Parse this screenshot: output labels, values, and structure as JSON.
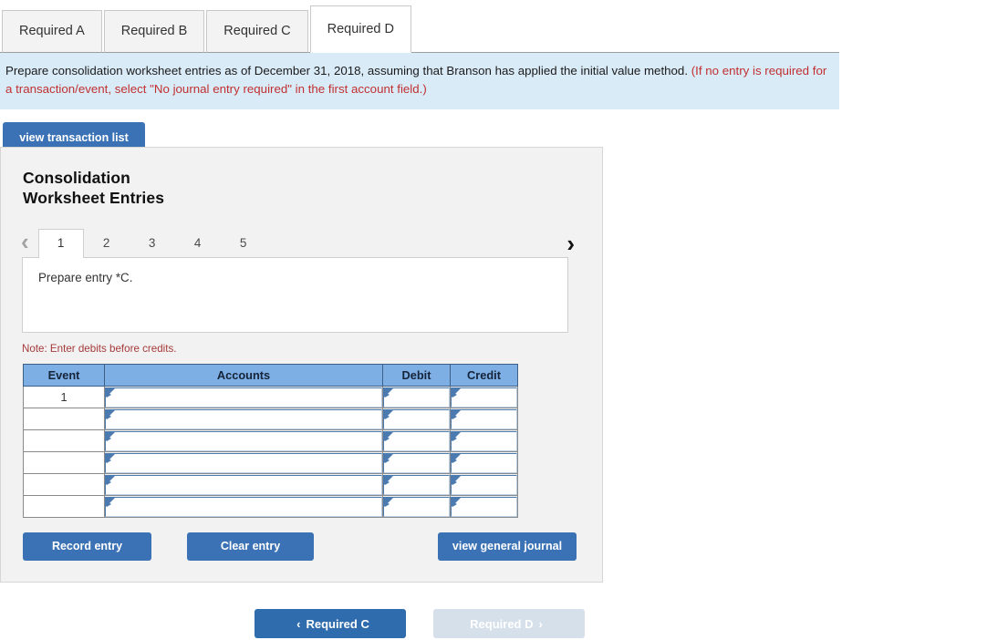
{
  "tabs": [
    {
      "label": "Required A",
      "active": false
    },
    {
      "label": "Required B",
      "active": false
    },
    {
      "label": "Required C",
      "active": false
    },
    {
      "label": "Required D",
      "active": true
    }
  ],
  "banner": {
    "main": "Prepare consolidation worksheet entries as of December 31, 2018, assuming that Branson has applied the initial value method.",
    "hint": "(If no entry is required for a transaction/event, select \"No journal entry required\" in the first account field.)"
  },
  "toolbar": {
    "view_transaction_list": "view transaction list"
  },
  "panel": {
    "title_line1": "Consolidation",
    "title_line2": "Worksheet Entries",
    "pager": {
      "prev_icon": "‹",
      "next_icon": "›",
      "pages": [
        "1",
        "2",
        "3",
        "4",
        "5"
      ],
      "active_page": "1"
    },
    "entry_description": "Prepare entry *C.",
    "note": "Note: Enter debits before credits.",
    "table": {
      "headers": [
        "Event",
        "Accounts",
        "Debit",
        "Credit"
      ],
      "rows": [
        {
          "event": "1",
          "accounts": "",
          "debit": "",
          "credit": ""
        },
        {
          "event": "",
          "accounts": "",
          "debit": "",
          "credit": ""
        },
        {
          "event": "",
          "accounts": "",
          "debit": "",
          "credit": ""
        },
        {
          "event": "",
          "accounts": "",
          "debit": "",
          "credit": ""
        },
        {
          "event": "",
          "accounts": "",
          "debit": "",
          "credit": ""
        },
        {
          "event": "",
          "accounts": "",
          "debit": "",
          "credit": ""
        }
      ]
    },
    "actions": {
      "record_entry": "Record entry",
      "clear_entry": "Clear entry",
      "view_general_journal": "view general journal"
    }
  },
  "bottom_nav": {
    "prev_label": "Required C",
    "prev_icon": "‹",
    "next_label": "Required D",
    "next_icon": "›",
    "next_disabled": true
  },
  "colors": {
    "accent_blue": "#3a72b5",
    "table_header_blue": "#7dafe4",
    "banner_blue": "#daebf8",
    "panel_gray": "#f2f2f2",
    "hint_red": "#c03030",
    "note_red": "#a63a3a"
  }
}
